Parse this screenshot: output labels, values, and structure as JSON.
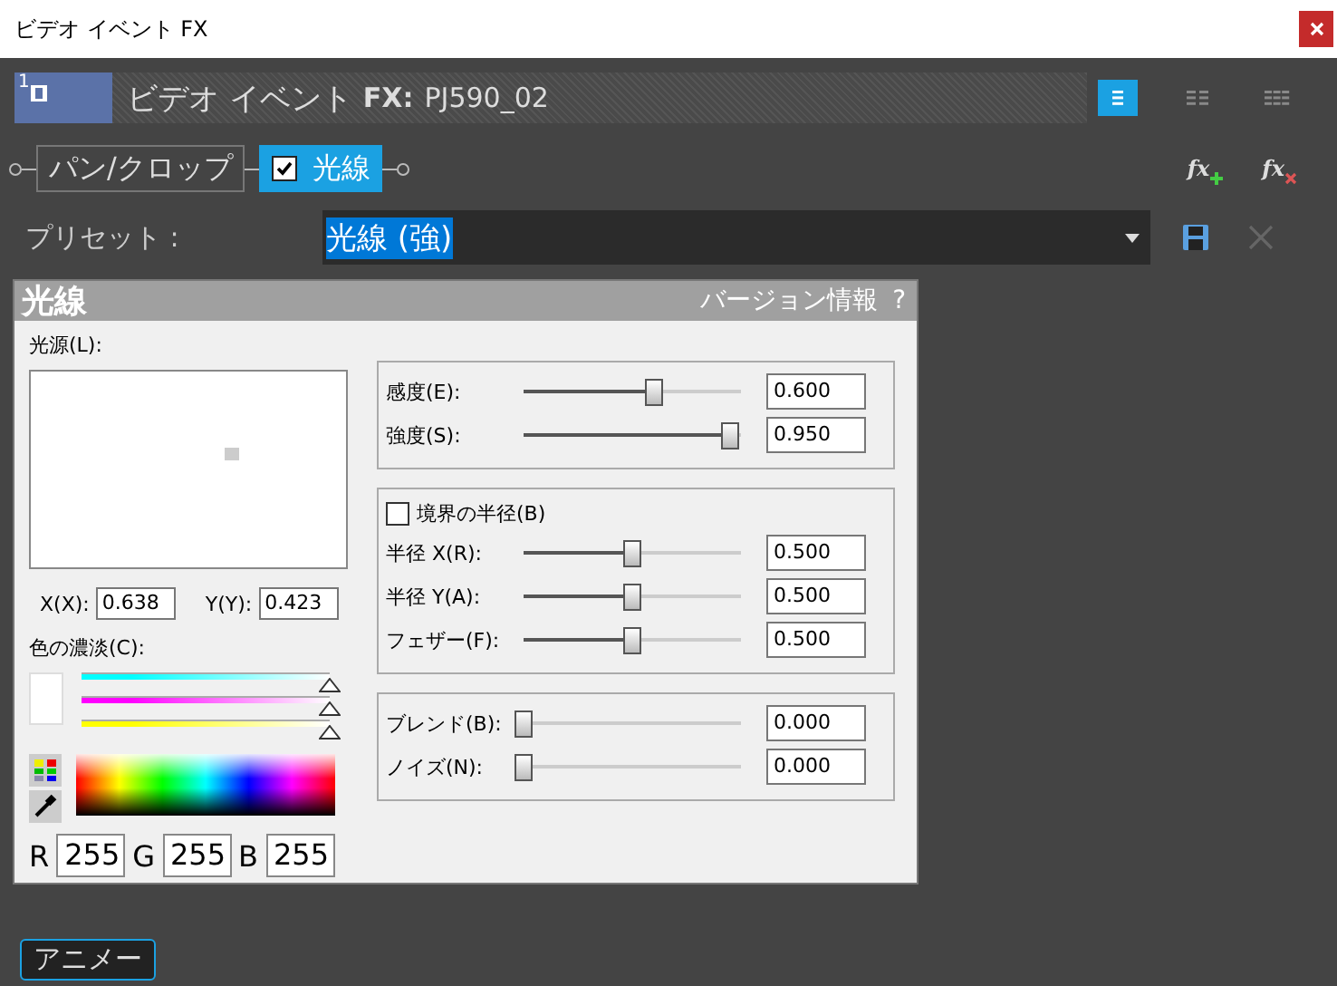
{
  "window": {
    "title": "ビデオ イベント FX"
  },
  "header": {
    "track_number": "1",
    "event_label": "ビデオ イベント",
    "fx_label": "FX:",
    "fx_name": "PJ590_02"
  },
  "view_buttons": [
    {
      "kind": "single",
      "selected": true
    },
    {
      "kind": "double",
      "selected": false
    },
    {
      "kind": "triple",
      "selected": false
    }
  ],
  "chain": [
    {
      "label": "パン/クロップ",
      "kind": "plain",
      "selected": false
    },
    {
      "label": "光線",
      "kind": "checkbox",
      "checked": true,
      "selected": true
    }
  ],
  "fx_buttons": [
    {
      "text": "fx",
      "kind": "add"
    },
    {
      "text": "fx",
      "kind": "remove"
    }
  ],
  "preset": {
    "label": "プリセット :",
    "value": "光線 (強)"
  },
  "plugin": {
    "title": "光線",
    "version_link": "バージョン情報",
    "help": "?",
    "light_source": {
      "label": "光源(L):",
      "x_label": "X(X):",
      "x_value": "0.638",
      "y_label": "Y(Y):",
      "y_value": "0.423"
    },
    "color": {
      "label": "色の濃淡(C):",
      "channels": [
        {
          "color": "#00ffff",
          "level": 1
        },
        {
          "color": "#ff00ff",
          "level": 1
        },
        {
          "color": "#ffff00",
          "level": 1
        }
      ],
      "rgb": [
        {
          "label": "R",
          "value": "255"
        },
        {
          "label": "G",
          "value": "255"
        },
        {
          "label": "B",
          "value": "255"
        }
      ]
    },
    "groups": [
      {
        "sliders": [
          {
            "label": "感度(E):",
            "level": 0.6,
            "value": "0.600"
          },
          {
            "label": "強度(S):",
            "level": 0.95,
            "value": "0.950"
          }
        ]
      },
      {
        "checkbox": {
          "label": "境界の半径(B)",
          "checked": false
        },
        "sliders": [
          {
            "label": "半径 X(R):",
            "level": 0.5,
            "value": "0.500"
          },
          {
            "label": "半径 Y(A):",
            "level": 0.5,
            "value": "0.500"
          },
          {
            "label": "フェザー(F):",
            "level": 0.5,
            "value": "0.500"
          }
        ]
      },
      {
        "sliders": [
          {
            "label": "ブレンド(B):",
            "level": 0,
            "value": "0.000"
          },
          {
            "label": "ノイズ(N):",
            "level": 0,
            "value": "0.000"
          }
        ]
      }
    ]
  },
  "anim_button": "アニメー"
}
